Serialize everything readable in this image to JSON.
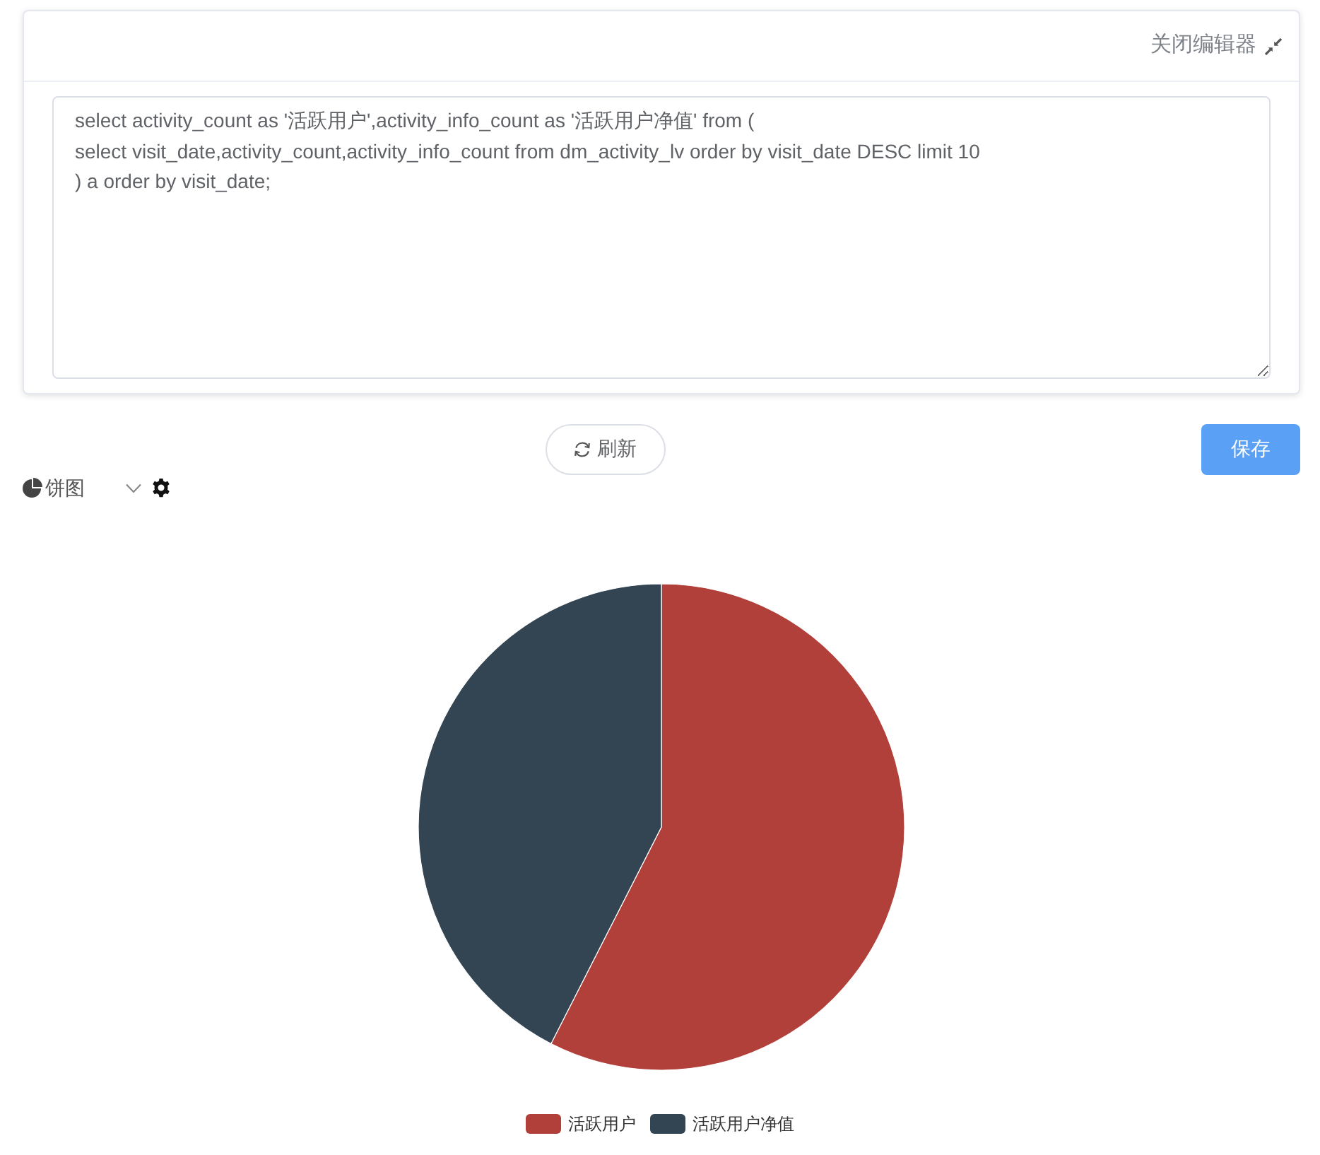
{
  "header": {
    "close_editor": "关闭编辑器"
  },
  "editor": {
    "value": "select activity_count as '活跃用户',activity_info_count as '活跃用户净值' from (\nselect visit_date,activity_count,activity_info_count from dm_activity_lv order by visit_date DESC limit 10\n) a order by visit_date;"
  },
  "actions": {
    "refresh": "刷新",
    "save": "保存"
  },
  "chart_type": {
    "value": "饼图"
  },
  "chart": {
    "legend": [
      {
        "label": "活跃用户",
        "color": "#b2403a"
      },
      {
        "label": "活跃用户净值",
        "color": "#334553"
      }
    ]
  }
}
